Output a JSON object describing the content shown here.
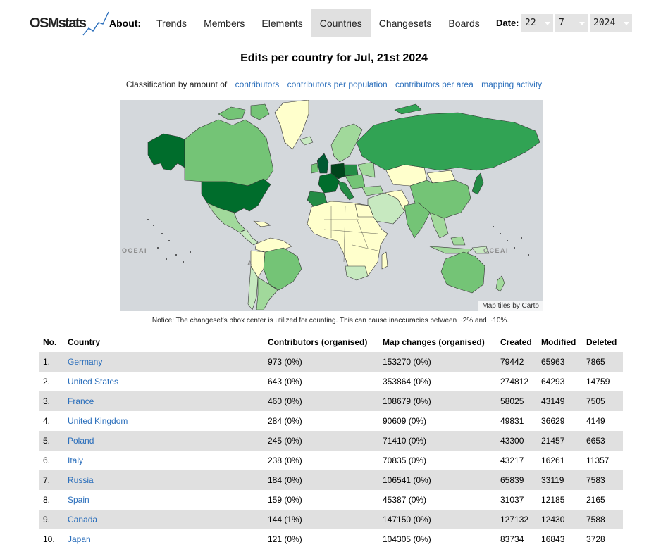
{
  "header": {
    "logo_text": "OSMstats",
    "about_label": "About:",
    "nav": [
      {
        "label": "Trends",
        "active": false
      },
      {
        "label": "Members",
        "active": false
      },
      {
        "label": "Elements",
        "active": false
      },
      {
        "label": "Countries",
        "active": true
      },
      {
        "label": "Changesets",
        "active": false
      },
      {
        "label": "Boards",
        "active": false
      }
    ],
    "date_label": "Date:",
    "day": "22",
    "month": "7",
    "year": "2024"
  },
  "page_title": "Edits per country for Jul, 21st 2024",
  "classification": {
    "label": "Classification by amount of",
    "options": [
      "contributors",
      "contributors per population",
      "contributors per area",
      "mapping activity"
    ]
  },
  "map": {
    "attribution": "Map tiles by Carto",
    "ocean_labels": [
      "OCEAI",
      "OCEAI",
      "A"
    ]
  },
  "notice": "Notice: The changeset's bbox center is utilized for counting. This can cause inaccuracies between ~2% and ~10%.",
  "table": {
    "headers": [
      "No.",
      "Country",
      "Contributors (organised)",
      "Map changes (organised)",
      "Created",
      "Modified",
      "Deleted"
    ],
    "rows": [
      {
        "no": "1.",
        "country": "Germany",
        "contributors": "973 (0%)",
        "changes": "153270 (0%)",
        "created": "79442",
        "modified": "65963",
        "deleted": "7865"
      },
      {
        "no": "2.",
        "country": "United States",
        "contributors": "643 (0%)",
        "changes": "353864 (0%)",
        "created": "274812",
        "modified": "64293",
        "deleted": "14759"
      },
      {
        "no": "3.",
        "country": "France",
        "contributors": "460 (0%)",
        "changes": "108679 (0%)",
        "created": "58025",
        "modified": "43149",
        "deleted": "7505"
      },
      {
        "no": "4.",
        "country": "United Kingdom",
        "contributors": "284 (0%)",
        "changes": "90609 (0%)",
        "created": "49831",
        "modified": "36629",
        "deleted": "4149"
      },
      {
        "no": "5.",
        "country": "Poland",
        "contributors": "245 (0%)",
        "changes": "71410 (0%)",
        "created": "43300",
        "modified": "21457",
        "deleted": "6653"
      },
      {
        "no": "6.",
        "country": "Italy",
        "contributors": "238 (0%)",
        "changes": "70835 (0%)",
        "created": "43217",
        "modified": "16261",
        "deleted": "11357"
      },
      {
        "no": "7.",
        "country": "Russia",
        "contributors": "184 (0%)",
        "changes": "106541 (0%)",
        "created": "65839",
        "modified": "33119",
        "deleted": "7583"
      },
      {
        "no": "8.",
        "country": "Spain",
        "contributors": "159 (0%)",
        "changes": "45387 (0%)",
        "created": "31037",
        "modified": "12185",
        "deleted": "2165"
      },
      {
        "no": "9.",
        "country": "Canada",
        "contributors": "144 (1%)",
        "changes": "147150 (0%)",
        "created": "127132",
        "modified": "12430",
        "deleted": "7588"
      },
      {
        "no": "10.",
        "country": "Japan",
        "contributors": "121 (0%)",
        "changes": "104305 (0%)",
        "created": "83734",
        "modified": "16843",
        "deleted": "3728"
      }
    ]
  }
}
